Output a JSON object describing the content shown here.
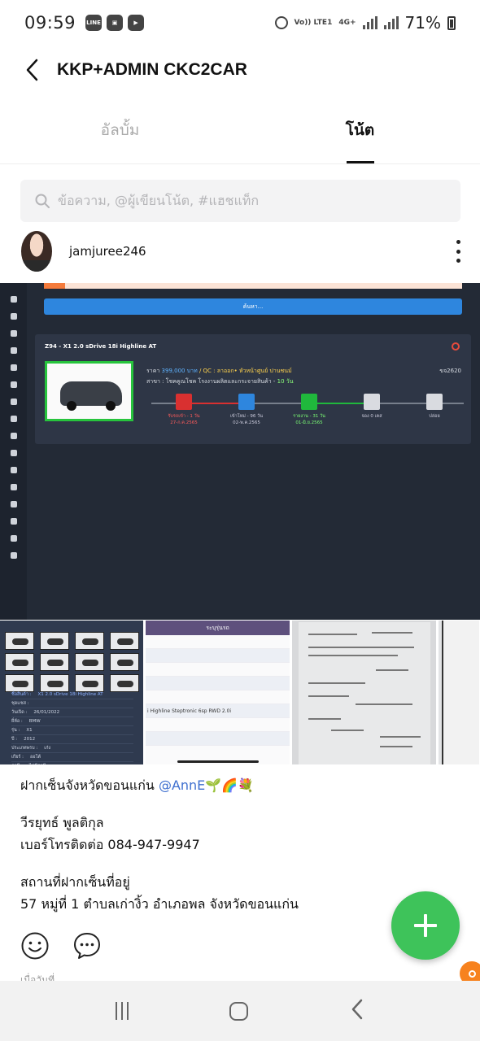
{
  "status_bar": {
    "time": "09:59",
    "network": "Vo)) LTE1",
    "network_gen": "4G+",
    "battery": "71%"
  },
  "app_bar": {
    "title": "KKP+ADMIN CKC2CAR",
    "back_icon": "chevron-left-icon"
  },
  "tabs": [
    {
      "label": "อัลบั้ม",
      "active": false
    },
    {
      "label": "โน้ต",
      "active": true
    }
  ],
  "search": {
    "placeholder": "ข้อความ, @ผู้เขียนโน้ต, #แฮชแท็ก",
    "icon": "search-icon"
  },
  "post": {
    "author": "jamjuree246",
    "image": {
      "search_button": "ค้นหา...",
      "car_title": "Z94 - X1 2.0 sDrive 18i Highline AT",
      "price_label": "ราคา",
      "price": "399,000 บาท",
      "qc": "/ QC : ลาออก• หัวหน้าศูนย์ ปานชนม์",
      "branch": "สาขา : โชคคูณโชค โรงงานผลิตและกระจายสินค้า -",
      "branch_days": "10 วัน",
      "code": "ขจ2620",
      "steps": [
        {
          "label": "รับรถเข้า - 1 วัน",
          "date": "27-ก.ค.2565",
          "color": "#d93030",
          "tone": "red"
        },
        {
          "label": "เข้าโหม่ - 96 วัน",
          "date": "02-พ.ค.2565",
          "color": "#2e86de",
          "tone": ""
        },
        {
          "label": "รายงาน - 31 วัน",
          "date": "01-มิ.ย.2565",
          "color": "#20b83c",
          "tone": "green"
        },
        {
          "label": "จอง 0 เคส",
          "date": "",
          "color": "#d9dbe0",
          "tone": ""
        },
        {
          "label": "ปล่อย",
          "date": "",
          "color": "#d9dbe0",
          "tone": ""
        }
      ]
    },
    "gallery": {
      "g1_form": [
        {
          "label": "ชื่อสินค้า :",
          "value": "X1 2.0 sDrive 18i Highline AT",
          "header": true
        },
        {
          "label": "ชุดแชส :",
          "value": "",
          "header": false
        },
        {
          "label": "วันเปิด :",
          "value": "26/01/2022",
          "header": false
        },
        {
          "label": "ยี่ห้อ :",
          "value": "BMW",
          "header": false
        },
        {
          "label": "รุ่น :",
          "value": "X1",
          "header": false
        },
        {
          "label": "ปี :",
          "value": "2012",
          "header": false
        },
        {
          "label": "ประเภทพรบ :",
          "value": "เก๋ง",
          "header": false
        },
        {
          "label": "เกียร์ :",
          "value": "ออโต้",
          "header": false
        },
        {
          "label": "ภาษี :",
          "value": "ไม่มีภาษี",
          "header": false
        }
      ],
      "g2_header": "ระบุรุ่นรถ",
      "g2_row": "i Highline Steptronic 6sp RWD 2.0i"
    },
    "lines": {
      "l1": "ฝากเซ็นจังหวัดขอนแก่น ",
      "mention": "@AnnE",
      "emoji": "🌱🌈💐",
      "l2": "วีรยุทธ์ พูลติกุล",
      "l3": "เบอร์โทรติดต่อ 084-947-9947",
      "l4": "สถานที่ฝากเซ็นที่อยู่",
      "l5": "57 หมู่ที่ 1 ตำบลเก่างิ้ว อำเภอพล จังหวัดขอนแก่น"
    },
    "faded_text": "เมื่อวันที่"
  },
  "icons": {
    "smile": "smile-icon",
    "comment": "comment-icon",
    "fab": "plus-icon"
  },
  "colors": {
    "fab": "#3ec35a",
    "mention": "#3e6fcf"
  }
}
